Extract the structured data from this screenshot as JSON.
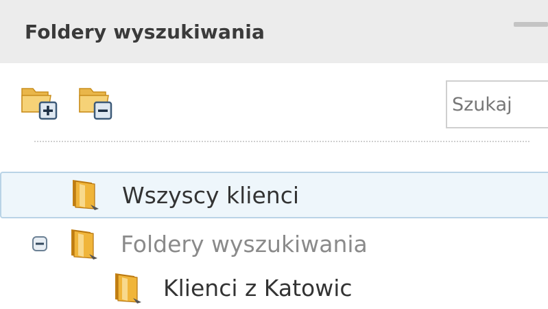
{
  "panel": {
    "title": "Foldery wyszukiwania"
  },
  "toolbar": {
    "add_folder_icon": "folder-add-icon",
    "remove_folder_icon": "folder-remove-icon",
    "search_placeholder": "Szukaj"
  },
  "tree": {
    "items": [
      {
        "label": "Wszyscy klienci",
        "icon": "folder-icon",
        "selected": true
      },
      {
        "label": "Foldery wyszukiwania",
        "icon": "folder-icon",
        "expanded": true
      },
      {
        "label": "Klienci z Katowic",
        "icon": "folder-icon"
      }
    ]
  },
  "colors": {
    "header_bg": "#ececec",
    "selection_bg": "#eef6fb",
    "selection_border": "#b9d3e6",
    "folder_orange": "#e8a21e"
  }
}
